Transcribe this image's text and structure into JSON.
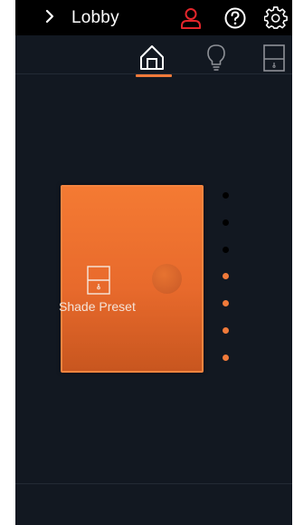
{
  "header": {
    "title": "Lobby",
    "back_icon": "chevron-right-icon",
    "user_icon": "user-icon",
    "help_icon": "help-circle-icon",
    "settings_icon": "gear-icon"
  },
  "tabs": [
    {
      "name": "home",
      "icon": "home-icon",
      "active": true
    },
    {
      "name": "lighting",
      "icon": "lightbulb-icon",
      "active": false
    },
    {
      "name": "shades",
      "icon": "shade-icon",
      "active": false
    }
  ],
  "preset": {
    "label": "Shade Preset",
    "icon": "shade-icon"
  },
  "page_indicator": {
    "count": 7,
    "states": [
      "off",
      "off",
      "off",
      "on",
      "on",
      "on",
      "on"
    ]
  },
  "colors": {
    "accent": "#f07a3a",
    "user_icon": "#e3262b",
    "background": "#121821",
    "topbar": "#000000",
    "dot_off": "#000000"
  }
}
